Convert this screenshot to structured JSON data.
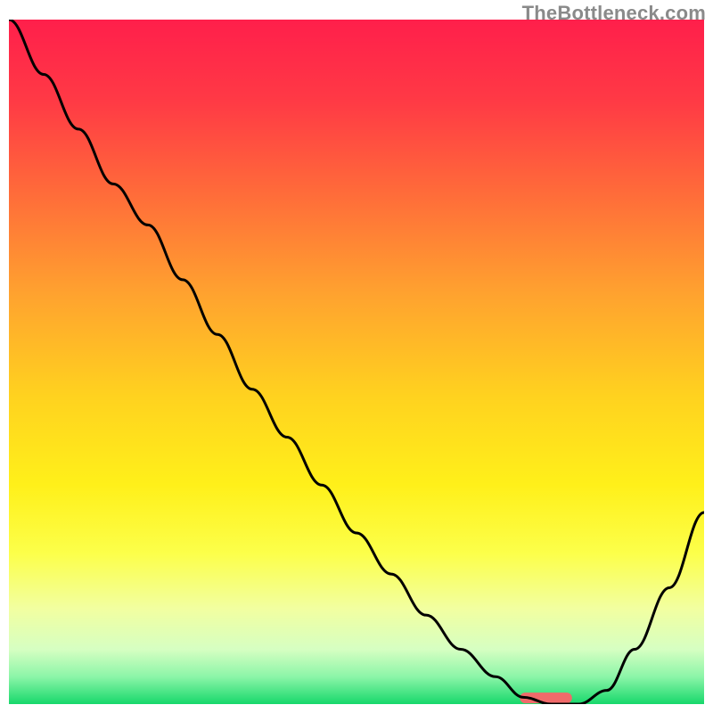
{
  "watermark": "TheBottleneck.com",
  "chart_data": {
    "type": "line",
    "title": "",
    "xlabel": "",
    "ylabel": "",
    "xlim": [
      0,
      100
    ],
    "ylim": [
      0,
      100
    ],
    "grid": false,
    "legend": false,
    "series": [
      {
        "name": "curve",
        "x": [
          0,
          5,
          10,
          15,
          20,
          25,
          30,
          35,
          40,
          45,
          50,
          55,
          60,
          65,
          70,
          74,
          78,
          82,
          86,
          90,
          95,
          100
        ],
        "y": [
          100,
          92,
          84,
          76,
          70,
          62,
          54,
          46,
          39,
          32,
          25,
          19,
          13,
          8,
          4,
          1,
          0,
          0,
          2,
          8,
          17,
          28
        ]
      }
    ],
    "optimal_marker": {
      "x_start": 73.5,
      "x_end": 81,
      "y": 0.9,
      "color": "#f06a6a"
    },
    "gradient_stops": [
      {
        "offset": 0.0,
        "color": "#ff1f4b"
      },
      {
        "offset": 0.12,
        "color": "#ff3a45"
      },
      {
        "offset": 0.25,
        "color": "#ff6a3a"
      },
      {
        "offset": 0.4,
        "color": "#ffa22f"
      },
      {
        "offset": 0.55,
        "color": "#ffd21f"
      },
      {
        "offset": 0.68,
        "color": "#fff01a"
      },
      {
        "offset": 0.78,
        "color": "#fcff4a"
      },
      {
        "offset": 0.86,
        "color": "#f2ffa0"
      },
      {
        "offset": 0.92,
        "color": "#d6ffc2"
      },
      {
        "offset": 0.96,
        "color": "#8cf5a8"
      },
      {
        "offset": 1.0,
        "color": "#17d86b"
      }
    ],
    "stroke_color": "#000000",
    "stroke_width": 3
  }
}
